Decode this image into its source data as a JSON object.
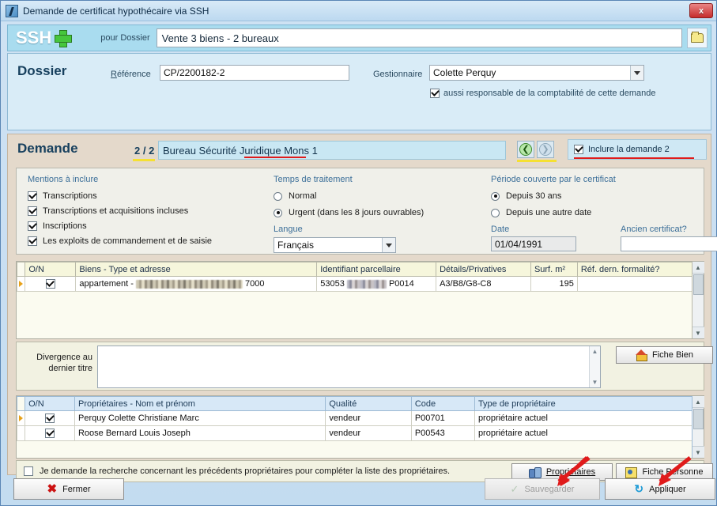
{
  "window": {
    "title": "Demande de certificat hypothécaire via SSH",
    "close_label": "x",
    "icon": "app-icon"
  },
  "header": {
    "logo_text": "SSH",
    "plus_icon": "plus-icon",
    "pour_dossier_label": "pour Dossier",
    "dossier_value": "Vente  3 biens - 2 bureaux",
    "folder_icon": "folder-icon"
  },
  "dossier": {
    "title": "Dossier",
    "reference_label": "Référence",
    "reference_value": "CP/2200182-2",
    "gestionnaire_label": "Gestionnaire",
    "gestionnaire_value": "Colette Perquy",
    "responsable_checkbox_label": "aussi responsable de la comptabilité de cette demande",
    "responsable_checked": true
  },
  "demande": {
    "title": "Demande",
    "counter": "2 / 2",
    "bureau_value": "Bureau Sécurité Juridique Mons 1",
    "prev_icon": "arrow-left-circle-icon",
    "next_icon": "arrow-right-circle-icon",
    "inclure_label": "Inclure la demande 2",
    "inclure_checked": true
  },
  "options": {
    "mentions": {
      "title": "Mentions à inclure",
      "items": [
        {
          "label": "Transcriptions",
          "checked": true
        },
        {
          "label": "Transcriptions et acquisitions incluses",
          "checked": true
        },
        {
          "label": "Inscriptions",
          "checked": true
        },
        {
          "label": "Les exploits de commandement et de saisie",
          "checked": true
        }
      ]
    },
    "temps": {
      "title": "Temps de traitement",
      "items": [
        {
          "label": "Normal",
          "selected": false
        },
        {
          "label": "Urgent (dans les 8 jours ouvrables)",
          "selected": true
        }
      ],
      "langue_label": "Langue",
      "langue_value": "Français"
    },
    "periode": {
      "title": "Période couverte par le certificat",
      "items": [
        {
          "label": "Depuis 30 ans",
          "selected": true
        },
        {
          "label": "Depuis une autre date",
          "selected": false
        }
      ],
      "date_label": "Date",
      "date_value": "01/04/1991",
      "ancien_label": "Ancien certificat?",
      "ancien_value": ""
    }
  },
  "biens_grid": {
    "columns": [
      "O/N",
      "Biens - Type et adresse",
      "Identifiant parcellaire",
      "Détails/Privatives",
      "Surf. m²",
      "Réf. dern. formalité?"
    ],
    "rows": [
      {
        "checked": true,
        "type": "appartement",
        "separator": "-",
        "address_redacted": true,
        "postal_code": "7000",
        "parcel_prefix": "53053",
        "parcel_redacted": true,
        "parcel_suffix": "P0014",
        "details": "A3/B8/G8-C8",
        "surface": "195",
        "ref_formalite": ""
      }
    ]
  },
  "divergence": {
    "label_line1": "Divergence au",
    "label_line2": "dernier titre",
    "value": "",
    "fiche_bien_label": "Fiche Bien",
    "fiche_bien_icon": "house-icon"
  },
  "proprietaires_grid": {
    "columns": [
      "O/N",
      "Propriétaires - Nom et prénom",
      "Qualité",
      "Code",
      "Type de propriétaire"
    ],
    "rows": [
      {
        "checked": true,
        "nom": "Perquy Colette Christiane Marc",
        "qualite": "vendeur",
        "code": "P00701",
        "type": "propriétaire actuel"
      },
      {
        "checked": true,
        "nom": "Roose Bernard Louis Joseph",
        "qualite": "vendeur",
        "code": "P00543",
        "type": "propriétaire actuel"
      }
    ]
  },
  "bottom": {
    "recherche_label": "Je demande la recherche concernant les précédents propriétaires pour compléter la liste des propriétaires.",
    "recherche_checked": false,
    "proprietaires_button": "Propriétaires",
    "proprietaires_icon": "people-icon",
    "fiche_personne_button": "Fiche Personne",
    "fiche_personne_icon": "person-card-icon"
  },
  "footer": {
    "fermer_label": "Fermer",
    "fermer_icon": "close-x-icon",
    "sauvegarder_label": "Sauvegarder",
    "sauvegarder_icon": "check-icon",
    "sauvegarder_disabled": true,
    "appliquer_label": "Appliquer",
    "appliquer_icon": "refresh-icon"
  },
  "annotations": {
    "arrow_color": "#e01b1b",
    "underline_red": "#e01b1b",
    "underline_yellow": "#f5e032"
  },
  "colors": {
    "titlebar": "#cfe2f3",
    "band": "#a9dcef",
    "dossier_panel": "#d9ecf7",
    "demande_panel": "#e4d9cb",
    "grid_header_biens": "#f6f6dc",
    "grid_header_prop": "#d7e8f7",
    "row_checked": "#b6e79a",
    "row_highlight": "#fbfbb0"
  }
}
